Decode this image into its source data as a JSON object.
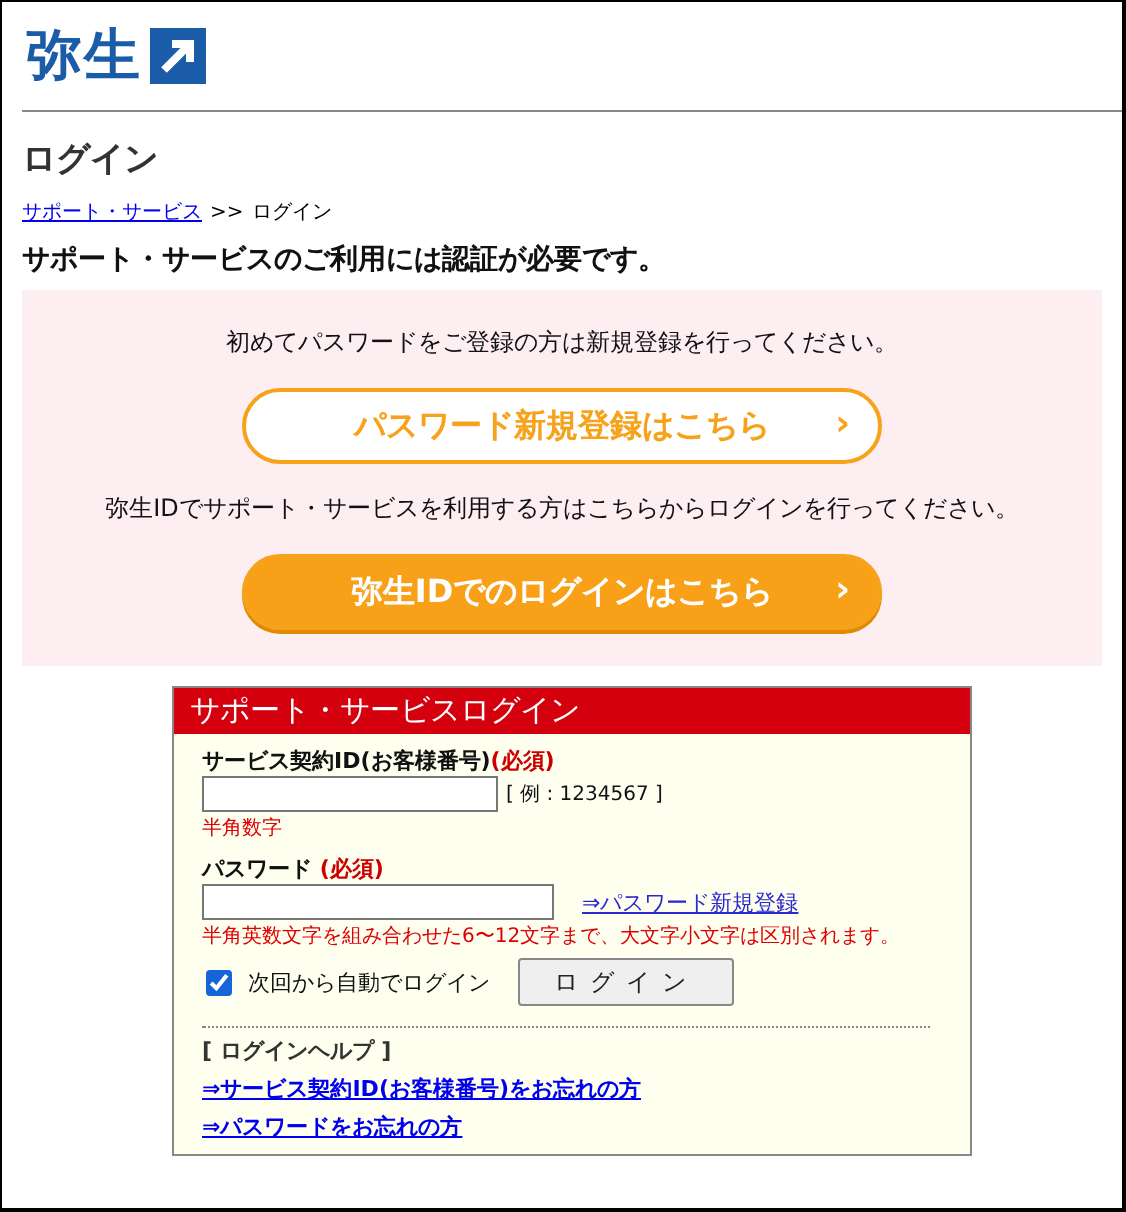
{
  "logo": {
    "text": "弥生"
  },
  "page_title": "ログイン",
  "breadcrumb": {
    "link": "サポート・サービス",
    "separator": ">>",
    "current": "ログイン"
  },
  "heading": "サポート・サービスのご利用には認証が必要です。",
  "info_panel": [
    {
      "kind": "outline",
      "text": "初めてパスワードをご登録の方は新規登録を行ってください。",
      "button": "パスワード新規登録はこちら",
      "chevron": "›"
    },
    {
      "kind": "filled",
      "text": "弥生IDでサポート・サービスを利用する方はこちらからログインを行ってください。",
      "button": "弥生IDでのログインはこちら",
      "chevron": "›"
    }
  ],
  "login_box": {
    "title": "サポート・サービスログイン",
    "id_field": {
      "label": "サービス契約ID(お客様番号)",
      "required": "(必須)",
      "example": "[ 例 : 1234567 ]",
      "hint": "半角数字"
    },
    "password_field": {
      "label": "パスワード",
      "required": "(必須)",
      "link": "⇒パスワード新規登録",
      "hint": "半角英数文字を組み合わせた6〜12文字まで、大文字小文字は区別されます。"
    },
    "auto_login": {
      "label": "次回から自動でログイン",
      "checked": true
    },
    "login_button": "ログイン",
    "help_title": "[ ログインヘルプ ]",
    "help_links": [
      "⇒サービス契約ID(お客様番号)をお忘れの方",
      "⇒パスワードをお忘れの方"
    ]
  }
}
